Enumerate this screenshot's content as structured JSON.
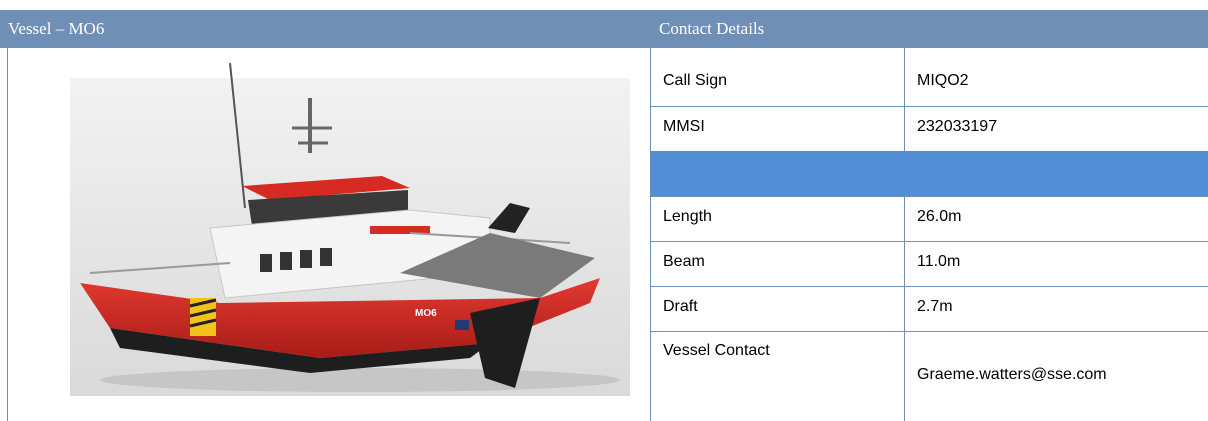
{
  "vessel_panel": {
    "title": "Vessel – MO6"
  },
  "contact_panel": {
    "title": "Contact Details",
    "rows": [
      {
        "label": "Call Sign",
        "value": "MIQO2"
      },
      {
        "label": "MMSI",
        "value": "232033197"
      },
      {
        "label": "",
        "value": ""
      },
      {
        "label": "Length",
        "value": "26.0m"
      },
      {
        "label": "Beam",
        "value": "11.0m"
      },
      {
        "label": "Draft",
        "value": "2.7m"
      },
      {
        "label": "Vessel Contact",
        "value": "Graeme.watters@sse.com"
      }
    ]
  },
  "vessel_image": {
    "hull_text": "MO6"
  },
  "colors": {
    "header": "#6f8fb7",
    "separator_row": "#538dd5",
    "hull_red": "#d72a23"
  }
}
